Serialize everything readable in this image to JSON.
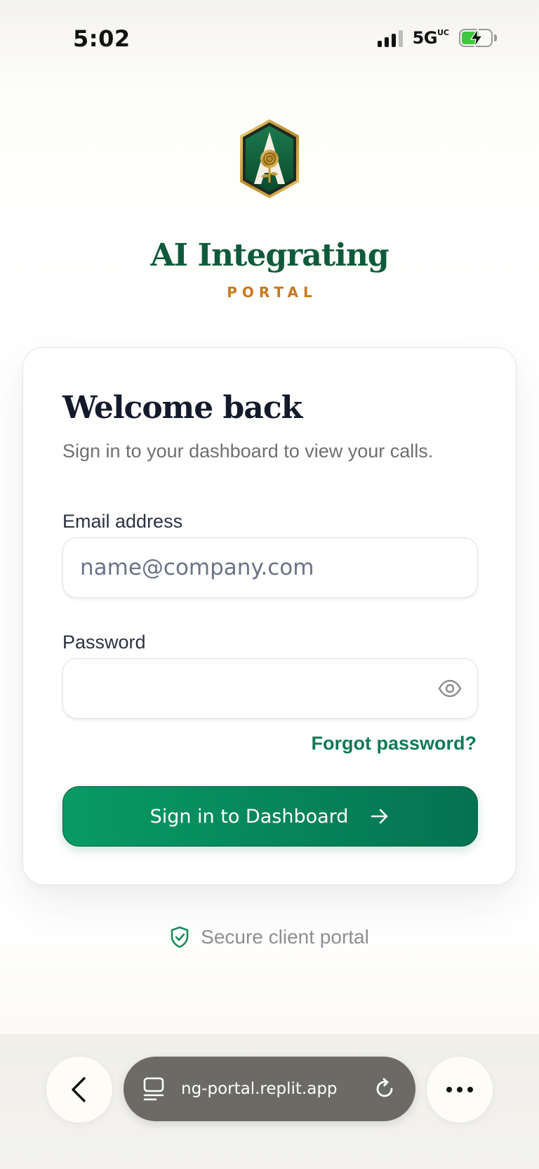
{
  "status_bar": {
    "time": "5:02",
    "network": "5G",
    "network_suffix": "UC"
  },
  "brand": {
    "logo_icon": "rose-a-badge-icon",
    "title": "AI Integrating",
    "subtitle": "PORTAL",
    "title_color": "#0f5a3c",
    "subtitle_color": "#c9781f"
  },
  "login_card": {
    "title": "Welcome back",
    "subtitle": "Sign in to your dashboard to view your calls.",
    "email_label": "Email address",
    "email_placeholder": "name@company.com",
    "email_value": "",
    "password_label": "Password",
    "password_value": "",
    "password_toggle_icon": "eye-icon",
    "forgot_password": "Forgot password?",
    "submit_label": "Sign in to Dashboard",
    "submit_icon": "arrow-right-icon",
    "accent_color": "#068359"
  },
  "footer": {
    "secure_icon": "shield-check-icon",
    "secure_text": "Secure client portal"
  },
  "browser": {
    "back_icon": "chevron-left-icon",
    "tabs_icon": "tabs-icon",
    "url": "ng-portal.replit.app",
    "reload_icon": "reload-icon",
    "more_icon": "ellipsis-icon"
  }
}
